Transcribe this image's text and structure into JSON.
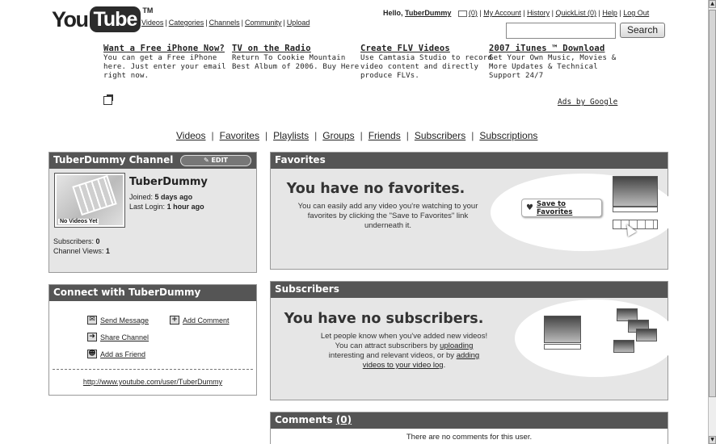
{
  "brand": {
    "you": "You",
    "tube": "Tube",
    "tm": "TM"
  },
  "topnav": [
    "Videos",
    "Categories",
    "Channels",
    "Community",
    "Upload"
  ],
  "userbar": {
    "hello": "Hello,",
    "user": "TuberDummy",
    "mail": "(0)",
    "links": [
      "My Account",
      "History",
      "QuickList (0)",
      "Help",
      "Log Out"
    ]
  },
  "search": {
    "button": "Search",
    "value": ""
  },
  "ads": [
    {
      "title": "Want a Free iPhone Now?",
      "lines": [
        "You can get a Free iPhone",
        "here. Just enter your email",
        "right now."
      ]
    },
    {
      "title": "TV on the Radio",
      "lines": [
        "Return To Cookie Mountain",
        "Best Album of 2006. Buy Here"
      ]
    },
    {
      "title": "Create FLV Videos",
      "lines": [
        "Use Camtasia Studio to record",
        "video content and directly",
        "produce FLVs."
      ]
    },
    {
      "title": "2007 iTunes ™ Download",
      "lines": [
        "Get Your Own Music, Movies &",
        "More Updates & Technical",
        "Support 24/7"
      ]
    }
  ],
  "ads_by": "Ads by Google",
  "channel_nav": [
    "Videos",
    "Favorites",
    "Playlists",
    "Groups",
    "Friends",
    "Subscribers",
    "Subscriptions"
  ],
  "channel": {
    "header": "TuberDummy Channel",
    "edit": "EDIT",
    "name": "TuberDummy",
    "no_videos": "No Videos Yet",
    "joined_label": "Joined:",
    "joined": "5 days ago",
    "login_label": "Last Login:",
    "login": "1 hour ago",
    "subs_label": "Subscribers:",
    "subs": "0",
    "views_label": "Channel Views:",
    "views": "1"
  },
  "connect": {
    "header": "Connect with TuberDummy",
    "send": "Send Message",
    "add_comment": "Add Comment",
    "share": "Share Channel",
    "add_friend": "Add as Friend",
    "url": "http://www.youtube.com/user/TuberDummy"
  },
  "favorites": {
    "header": "Favorites",
    "big": "You have no favorites.",
    "small": "You can easily add any video you're watching to your favorites by clicking the \"Save to Favorites\" link underneath it.",
    "save_link": "Save to Favorites"
  },
  "subscribers": {
    "header": "Subscribers",
    "big": "You have no subscribers.",
    "l1": "Let people know when you've added new videos!",
    "l2a": "You can attract subscribers by",
    "l2b": "uploading",
    "l3a": "interesting and relevant videos, or by",
    "l3b": "adding",
    "l4": "videos to your video log",
    "l4end": "."
  },
  "comments": {
    "header": "Comments",
    "count": "(0)",
    "empty": "There are no comments for this user."
  }
}
